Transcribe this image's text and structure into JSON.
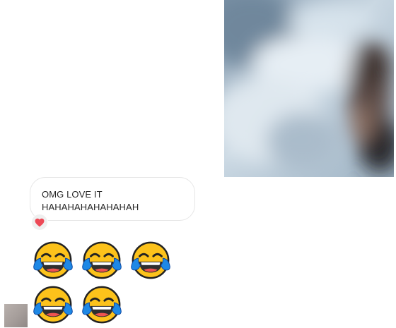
{
  "thread": {
    "shared_media": {
      "kind": "photo"
    },
    "received_message": {
      "lines": [
        "OMG LOVE IT",
        "HAHAHAHAHAHAHAH"
      ],
      "reaction_icon": "heart-icon",
      "reaction_color": "#ed4956"
    },
    "emoji_message": {
      "emojis": [
        "😂",
        "😂",
        "😂",
        "😂",
        "😂"
      ],
      "emoji_icon": "face-with-tears-of-joy-icon"
    },
    "sender_avatar": {
      "icon": "avatar"
    }
  }
}
